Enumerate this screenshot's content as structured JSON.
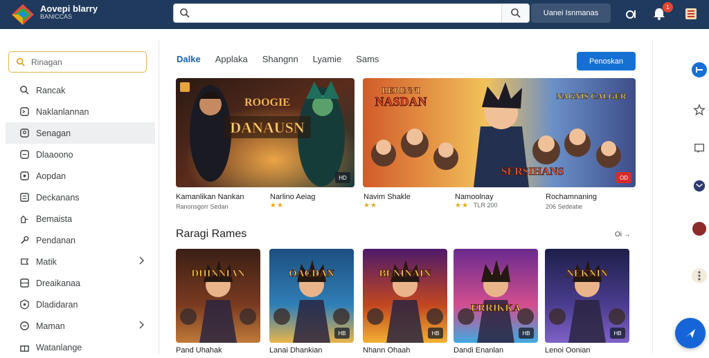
{
  "header": {
    "app_title": "Aovepi blarry",
    "app_subtitle": "BANICCAS",
    "account_button": "Uanei Isnmanas",
    "notification_count": "1"
  },
  "sidebar": {
    "search_label": "Rinagan",
    "items": [
      {
        "label": "Rancak",
        "icon": "search-icon"
      },
      {
        "label": "Naklanlannan",
        "icon": "chat-icon"
      },
      {
        "label": "Senagan",
        "icon": "users-icon",
        "active": true
      },
      {
        "label": "Dlaaoono",
        "icon": "document-icon"
      },
      {
        "label": "Aopdan",
        "icon": "person-icon"
      },
      {
        "label": "Deckanans",
        "icon": "list-icon"
      },
      {
        "label": "Bemaista",
        "icon": "puzzle-icon"
      },
      {
        "label": "Pendanan",
        "icon": "wrench-icon"
      },
      {
        "label": "Matik",
        "icon": "gamepad-icon",
        "has_chevron": true
      },
      {
        "label": "Dreaikanaa",
        "icon": "grid-icon"
      },
      {
        "label": "Dladidaran",
        "icon": "shield-icon"
      },
      {
        "label": "Maman",
        "icon": "history-icon",
        "has_chevron": true
      },
      {
        "label": "Watanlange",
        "icon": "gift-icon"
      }
    ]
  },
  "tabs": [
    "Dalke",
    "Applaka",
    "Shangnn",
    "Lyamie",
    "Sams"
  ],
  "primary_button": "Penoskan",
  "featured": [
    {
      "title": "DANAUSN",
      "art_caption": "ROOGIE",
      "badge": "HD"
    },
    {
      "title": "NASDAN",
      "art_caption": "BERINNI",
      "side_caption": "NAGNIS CALGER",
      "footer_caption": "SERSIHANS",
      "badge": "OD"
    }
  ],
  "featured_meta": [
    {
      "name": "Kamanlikan Nankan",
      "sub": "Ranonsgorr Sedan"
    },
    {
      "name": "Narlino Aeiag",
      "stars": "★★"
    },
    {
      "name": "Navim Shakle",
      "stars": "★★"
    },
    {
      "name": "Namoolnay",
      "stars": "★★",
      "sub": "TLR 200"
    },
    {
      "name": "Rochamnaning",
      "sub": "206 Sedeatie"
    }
  ],
  "section": {
    "title": "Raragi Rames",
    "more": "Oi →"
  },
  "games": [
    {
      "name": "Pand Uhahak",
      "art": "DHINNIAN",
      "badge": "",
      "colors": [
        "#3a1f16",
        "#7a3b20",
        "#c07a3a"
      ]
    },
    {
      "name": "Lanai Dhankian",
      "art": "OACDAN",
      "badge": "HB",
      "colors": [
        "#1d4f80",
        "#2f7fb6",
        "#e9b44a"
      ]
    },
    {
      "name": "Nhann Ohaah",
      "art": "BENINAIN",
      "badge": "HB",
      "colors": [
        "#4e1a6b",
        "#c2471f",
        "#f2b133"
      ]
    },
    {
      "name": "Dandi Enanlan",
      "art": "ERRIKKA",
      "badge": "HB",
      "colors": [
        "#6a2a8f",
        "#d24f8e",
        "#40a9e0"
      ]
    },
    {
      "name": "Lenoi Oonian",
      "art": "NEKNIN",
      "badge": "HB",
      "colors": [
        "#1d1f4a",
        "#4b3d8f",
        "#7f62c8"
      ]
    }
  ]
}
